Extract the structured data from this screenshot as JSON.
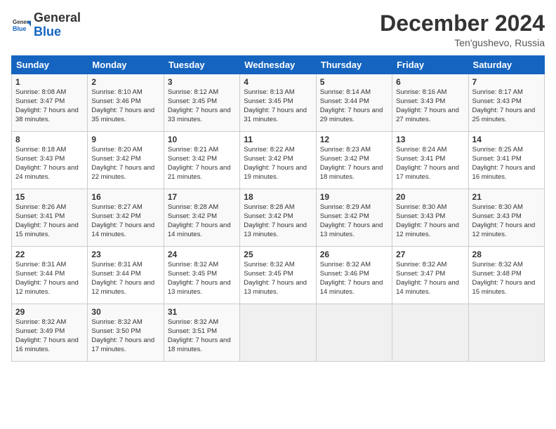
{
  "header": {
    "logo_general": "General",
    "logo_blue": "Blue",
    "month_title": "December 2024",
    "location": "Ten'gushevo, Russia"
  },
  "weekdays": [
    "Sunday",
    "Monday",
    "Tuesday",
    "Wednesday",
    "Thursday",
    "Friday",
    "Saturday"
  ],
  "weeks": [
    [
      {
        "day": "1",
        "sunrise": "Sunrise: 8:08 AM",
        "sunset": "Sunset: 3:47 PM",
        "daylight": "Daylight: 7 hours and 38 minutes."
      },
      {
        "day": "2",
        "sunrise": "Sunrise: 8:10 AM",
        "sunset": "Sunset: 3:46 PM",
        "daylight": "Daylight: 7 hours and 35 minutes."
      },
      {
        "day": "3",
        "sunrise": "Sunrise: 8:12 AM",
        "sunset": "Sunset: 3:45 PM",
        "daylight": "Daylight: 7 hours and 33 minutes."
      },
      {
        "day": "4",
        "sunrise": "Sunrise: 8:13 AM",
        "sunset": "Sunset: 3:45 PM",
        "daylight": "Daylight: 7 hours and 31 minutes."
      },
      {
        "day": "5",
        "sunrise": "Sunrise: 8:14 AM",
        "sunset": "Sunset: 3:44 PM",
        "daylight": "Daylight: 7 hours and 29 minutes."
      },
      {
        "day": "6",
        "sunrise": "Sunrise: 8:16 AM",
        "sunset": "Sunset: 3:43 PM",
        "daylight": "Daylight: 7 hours and 27 minutes."
      },
      {
        "day": "7",
        "sunrise": "Sunrise: 8:17 AM",
        "sunset": "Sunset: 3:43 PM",
        "daylight": "Daylight: 7 hours and 25 minutes."
      }
    ],
    [
      {
        "day": "8",
        "sunrise": "Sunrise: 8:18 AM",
        "sunset": "Sunset: 3:43 PM",
        "daylight": "Daylight: 7 hours and 24 minutes."
      },
      {
        "day": "9",
        "sunrise": "Sunrise: 8:20 AM",
        "sunset": "Sunset: 3:42 PM",
        "daylight": "Daylight: 7 hours and 22 minutes."
      },
      {
        "day": "10",
        "sunrise": "Sunrise: 8:21 AM",
        "sunset": "Sunset: 3:42 PM",
        "daylight": "Daylight: 7 hours and 21 minutes."
      },
      {
        "day": "11",
        "sunrise": "Sunrise: 8:22 AM",
        "sunset": "Sunset: 3:42 PM",
        "daylight": "Daylight: 7 hours and 19 minutes."
      },
      {
        "day": "12",
        "sunrise": "Sunrise: 8:23 AM",
        "sunset": "Sunset: 3:42 PM",
        "daylight": "Daylight: 7 hours and 18 minutes."
      },
      {
        "day": "13",
        "sunrise": "Sunrise: 8:24 AM",
        "sunset": "Sunset: 3:41 PM",
        "daylight": "Daylight: 7 hours and 17 minutes."
      },
      {
        "day": "14",
        "sunrise": "Sunrise: 8:25 AM",
        "sunset": "Sunset: 3:41 PM",
        "daylight": "Daylight: 7 hours and 16 minutes."
      }
    ],
    [
      {
        "day": "15",
        "sunrise": "Sunrise: 8:26 AM",
        "sunset": "Sunset: 3:41 PM",
        "daylight": "Daylight: 7 hours and 15 minutes."
      },
      {
        "day": "16",
        "sunrise": "Sunrise: 8:27 AM",
        "sunset": "Sunset: 3:42 PM",
        "daylight": "Daylight: 7 hours and 14 minutes."
      },
      {
        "day": "17",
        "sunrise": "Sunrise: 8:28 AM",
        "sunset": "Sunset: 3:42 PM",
        "daylight": "Daylight: 7 hours and 14 minutes."
      },
      {
        "day": "18",
        "sunrise": "Sunrise: 8:28 AM",
        "sunset": "Sunset: 3:42 PM",
        "daylight": "Daylight: 7 hours and 13 minutes."
      },
      {
        "day": "19",
        "sunrise": "Sunrise: 8:29 AM",
        "sunset": "Sunset: 3:42 PM",
        "daylight": "Daylight: 7 hours and 13 minutes."
      },
      {
        "day": "20",
        "sunrise": "Sunrise: 8:30 AM",
        "sunset": "Sunset: 3:43 PM",
        "daylight": "Daylight: 7 hours and 12 minutes."
      },
      {
        "day": "21",
        "sunrise": "Sunrise: 8:30 AM",
        "sunset": "Sunset: 3:43 PM",
        "daylight": "Daylight: 7 hours and 12 minutes."
      }
    ],
    [
      {
        "day": "22",
        "sunrise": "Sunrise: 8:31 AM",
        "sunset": "Sunset: 3:44 PM",
        "daylight": "Daylight: 7 hours and 12 minutes."
      },
      {
        "day": "23",
        "sunrise": "Sunrise: 8:31 AM",
        "sunset": "Sunset: 3:44 PM",
        "daylight": "Daylight: 7 hours and 12 minutes."
      },
      {
        "day": "24",
        "sunrise": "Sunrise: 8:32 AM",
        "sunset": "Sunset: 3:45 PM",
        "daylight": "Daylight: 7 hours and 13 minutes."
      },
      {
        "day": "25",
        "sunrise": "Sunrise: 8:32 AM",
        "sunset": "Sunset: 3:45 PM",
        "daylight": "Daylight: 7 hours and 13 minutes."
      },
      {
        "day": "26",
        "sunrise": "Sunrise: 8:32 AM",
        "sunset": "Sunset: 3:46 PM",
        "daylight": "Daylight: 7 hours and 14 minutes."
      },
      {
        "day": "27",
        "sunrise": "Sunrise: 8:32 AM",
        "sunset": "Sunset: 3:47 PM",
        "daylight": "Daylight: 7 hours and 14 minutes."
      },
      {
        "day": "28",
        "sunrise": "Sunrise: 8:32 AM",
        "sunset": "Sunset: 3:48 PM",
        "daylight": "Daylight: 7 hours and 15 minutes."
      }
    ],
    [
      {
        "day": "29",
        "sunrise": "Sunrise: 8:32 AM",
        "sunset": "Sunset: 3:49 PM",
        "daylight": "Daylight: 7 hours and 16 minutes."
      },
      {
        "day": "30",
        "sunrise": "Sunrise: 8:32 AM",
        "sunset": "Sunset: 3:50 PM",
        "daylight": "Daylight: 7 hours and 17 minutes."
      },
      {
        "day": "31",
        "sunrise": "Sunrise: 8:32 AM",
        "sunset": "Sunset: 3:51 PM",
        "daylight": "Daylight: 7 hours and 18 minutes."
      },
      null,
      null,
      null,
      null
    ]
  ]
}
